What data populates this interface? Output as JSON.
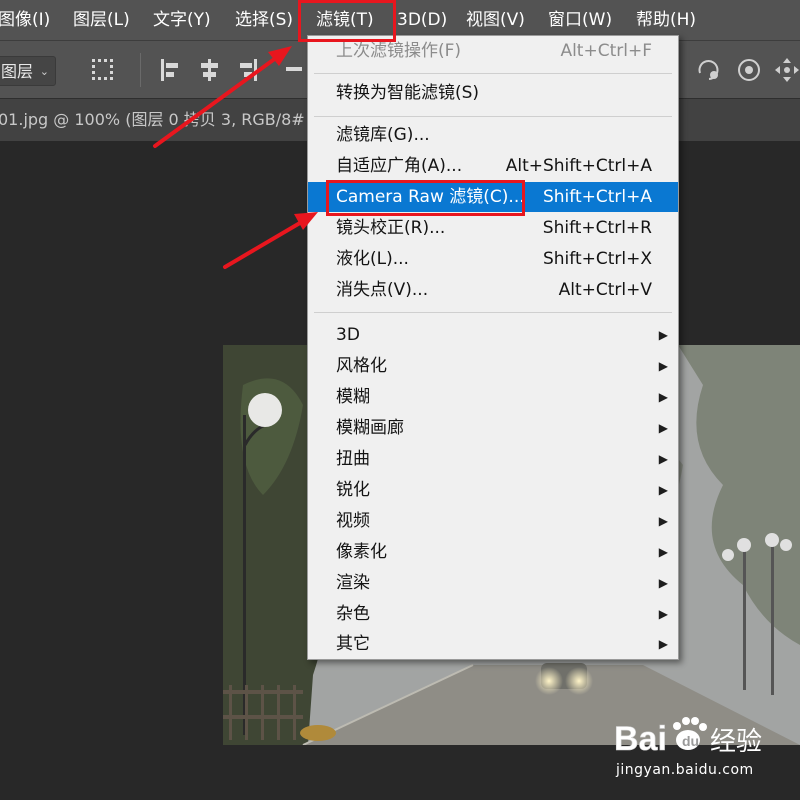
{
  "menubar": {
    "items": [
      {
        "label": "图像(I)"
      },
      {
        "label": "图层(L)"
      },
      {
        "label": "文字(Y)"
      },
      {
        "label": "选择(S)"
      },
      {
        "label": "滤镜(T)"
      },
      {
        "label": "3D(D)"
      },
      {
        "label": "视图(V)"
      },
      {
        "label": "窗口(W)"
      },
      {
        "label": "帮助(H)"
      }
    ],
    "active_index": 4
  },
  "options_bar": {
    "layer_select_value": "图层",
    "icons": [
      "marquee-icon",
      "align-left-icon",
      "align-center-icon",
      "align-right-icon",
      "align-top-icon",
      "rotate-3d-icon",
      "orbit-3d-icon",
      "pan-3d-icon"
    ]
  },
  "document_tab": {
    "title": "01.jpg @ 100% (图层 0 拷贝 3, RGB/8#"
  },
  "filter_menu": {
    "items": [
      {
        "label": "上次滤镜操作(F)",
        "shortcut": "Alt+Ctrl+F",
        "state": "disabled"
      },
      {
        "label": "转换为智能滤镜(S)",
        "shortcut": ""
      },
      {
        "label": "滤镜库(G)...",
        "shortcut": ""
      },
      {
        "label": "自适应广角(A)...",
        "shortcut": "Alt+Shift+Ctrl+A"
      },
      {
        "label": "Camera Raw 滤镜(C)...",
        "shortcut": "Shift+Ctrl+A",
        "state": "highlighted"
      },
      {
        "label": "镜头校正(R)...",
        "shortcut": "Shift+Ctrl+R"
      },
      {
        "label": "液化(L)...",
        "shortcut": "Shift+Ctrl+X"
      },
      {
        "label": "消失点(V)...",
        "shortcut": "Alt+Ctrl+V"
      },
      {
        "label": "3D",
        "submenu": true
      },
      {
        "label": "风格化",
        "submenu": true
      },
      {
        "label": "模糊",
        "submenu": true
      },
      {
        "label": "模糊画廊",
        "submenu": true
      },
      {
        "label": "扭曲",
        "submenu": true
      },
      {
        "label": "锐化",
        "submenu": true
      },
      {
        "label": "视频",
        "submenu": true
      },
      {
        "label": "像素化",
        "submenu": true
      },
      {
        "label": "渲染",
        "submenu": true
      },
      {
        "label": "杂色",
        "submenu": true
      },
      {
        "label": "其它",
        "submenu": true
      }
    ]
  },
  "watermark": {
    "brand": "Baidu经验",
    "url": "jingyan.baidu.com"
  },
  "colors": {
    "highlight": "#0a78d2",
    "annotation_red": "#e8161e",
    "menubar_bg": "#535353",
    "canvas_bg": "#282828"
  }
}
